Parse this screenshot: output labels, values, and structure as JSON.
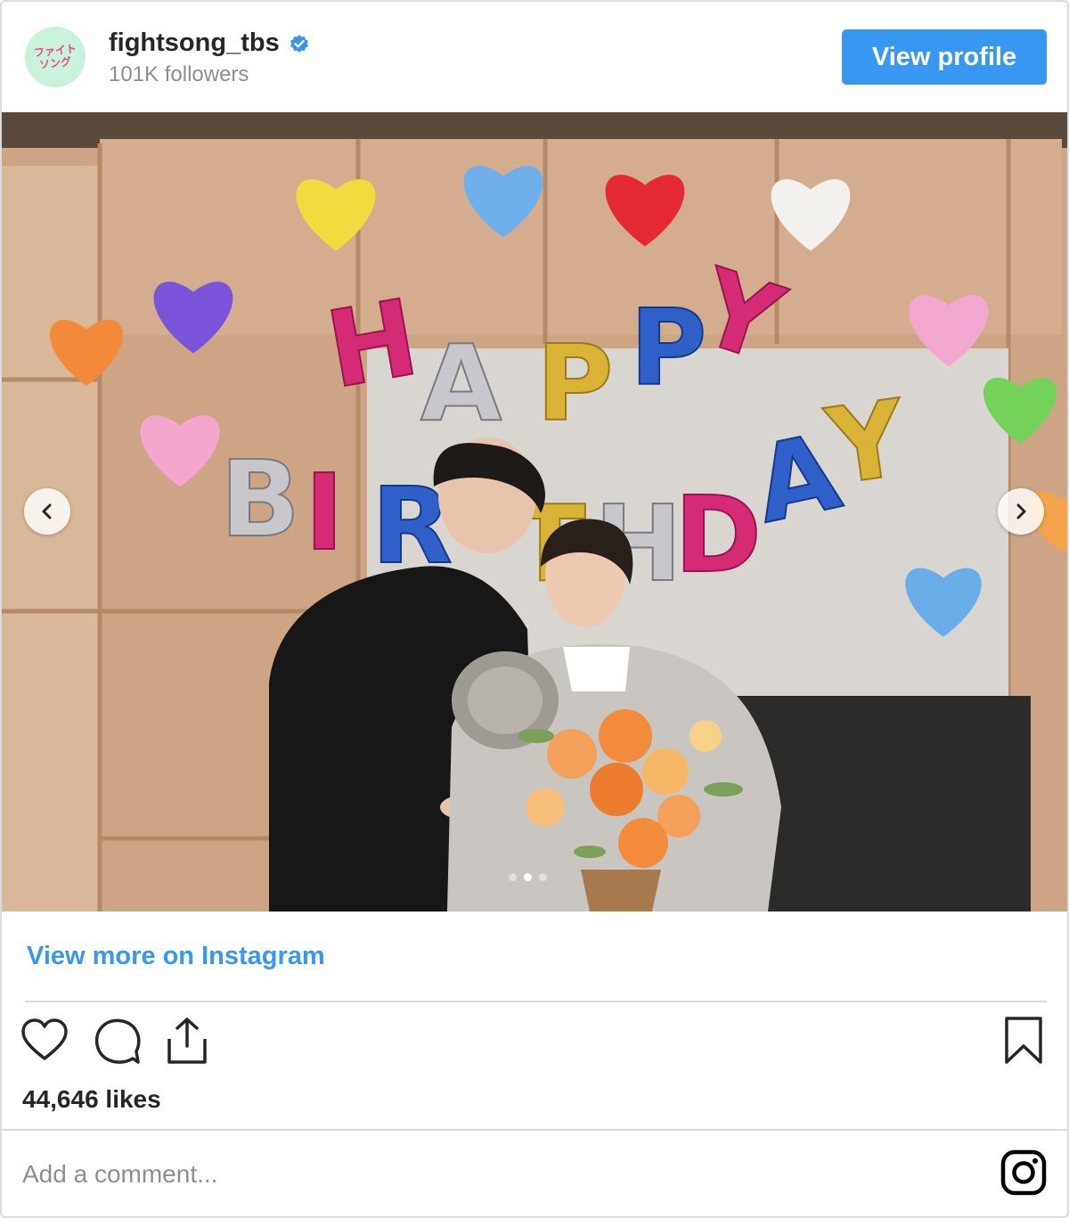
{
  "header": {
    "avatar_text_line1": "ファイト",
    "avatar_text_line2": "ソング",
    "username": "fightsong_tbs",
    "followers": "101K followers",
    "view_profile_label": "View profile"
  },
  "photo": {
    "balloon_text": "HAPPY BIRTHDAY",
    "carousel_dots": 3,
    "carousel_active_index": 1
  },
  "footer": {
    "view_more_label": "View more on Instagram",
    "likes": "44,646 likes",
    "comment_placeholder": "Add a comment..."
  },
  "icons": {
    "verified": "verified-badge-icon",
    "prev": "chevron-left-icon",
    "next": "chevron-right-icon",
    "like": "heart-icon",
    "comment": "comment-icon",
    "share": "share-icon",
    "save": "bookmark-icon",
    "instagram": "instagram-logo-icon"
  },
  "colors": {
    "accent": "#3897f0",
    "text": "#262626",
    "muted": "#8e8e8e",
    "border": "#dbdbdb"
  }
}
